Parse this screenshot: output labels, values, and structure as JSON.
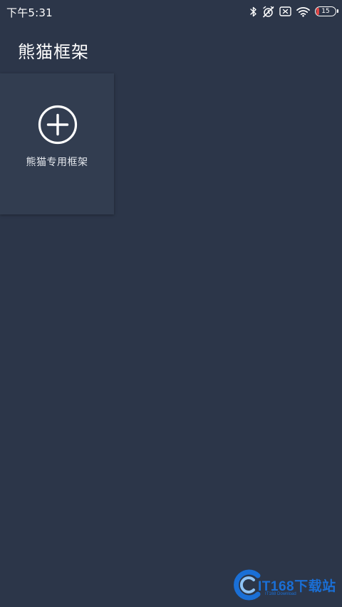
{
  "status_bar": {
    "time": "下午5:31",
    "icons": [
      "bluetooth-icon",
      "alarm-off-icon",
      "sim-off-icon",
      "wifi-icon",
      "battery-icon"
    ],
    "battery_level": "15",
    "battery_color": "#e04545"
  },
  "header": {
    "title": "熊猫框架"
  },
  "frames": [
    {
      "label": "熊猫专用框架",
      "icon": "add-circle-icon"
    }
  ],
  "watermark": {
    "text": "IT168下载站",
    "subtext": "IT168 Download"
  },
  "colors": {
    "background": "#2c3649",
    "card": "#323d50",
    "watermark": "#1a6fd6"
  }
}
